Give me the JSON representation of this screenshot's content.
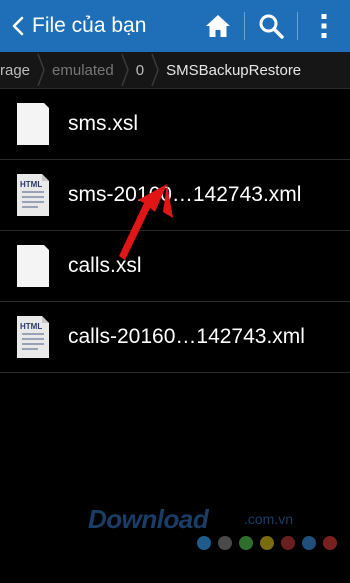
{
  "actionbar": {
    "title": "File của bạn",
    "icons": [
      "back-chevron-icon",
      "home-icon",
      "search-icon",
      "overflow-menu-icon"
    ],
    "color": "#1f6fb8"
  },
  "breadcrumb": {
    "items": [
      "rage",
      "emulated",
      "0",
      "SMSBackupRestore"
    ]
  },
  "files": [
    {
      "name": "sms.xsl",
      "icon": "blank-file-icon"
    },
    {
      "name": "sms-20160…142743.xml",
      "icon": "html-file-icon",
      "tag": "HTML"
    },
    {
      "name": "calls.xsl",
      "icon": "blank-file-icon"
    },
    {
      "name": "calls-20160…142743.xml",
      "icon": "html-file-icon",
      "tag": "HTML"
    }
  ],
  "annotation": {
    "color": "#e01515",
    "icon": "red-arrow-icon"
  },
  "watermark": {
    "text": "Download",
    "suffix": ".com.vn",
    "dot_colors": [
      "#1f5c8c",
      "#4a4a4a",
      "#2d6e2d",
      "#7a6a10",
      "#6a1f1f",
      "#1f4f7a",
      "#7a1f1f"
    ]
  }
}
